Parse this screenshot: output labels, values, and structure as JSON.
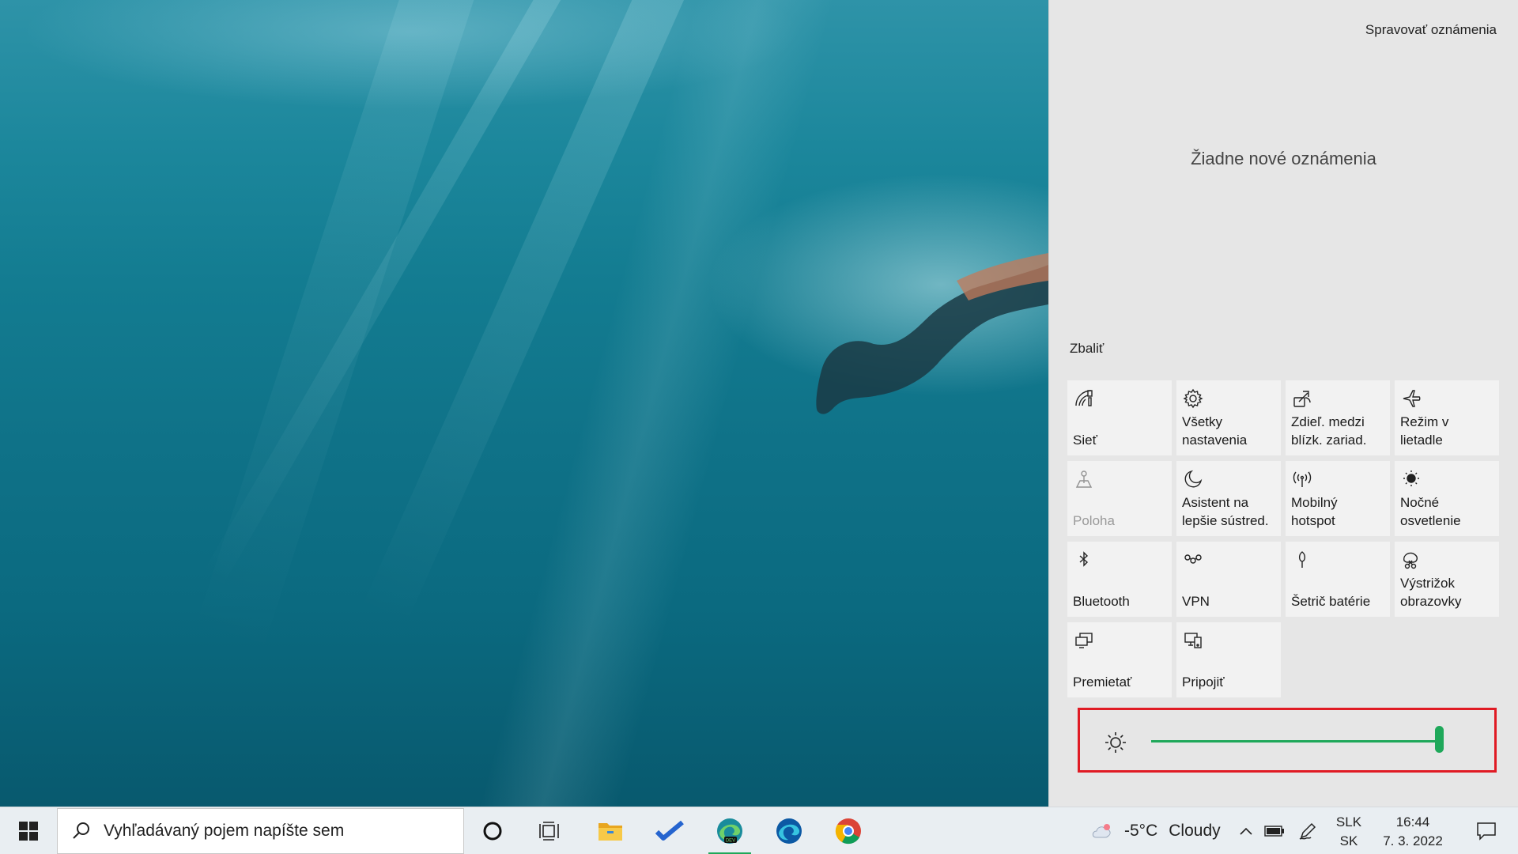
{
  "action_center": {
    "manage_notifications": "Spravovať oznámenia",
    "no_notifications": "Žiadne nové oznámenia",
    "collapse": "Zbaliť",
    "tiles": [
      {
        "label": "Sieť",
        "icon": "network-icon",
        "enabled": true
      },
      {
        "label": "Všetky nastavenia",
        "icon": "gear-icon",
        "enabled": true
      },
      {
        "label": "Zdieľ. medzi blízk. zariad.",
        "icon": "nearby-share-icon",
        "enabled": true
      },
      {
        "label": "Režim v lietadle",
        "icon": "airplane-icon",
        "enabled": true
      },
      {
        "label": "Poloha",
        "icon": "location-icon",
        "enabled": false
      },
      {
        "label": "Asistent na lepšie sústred.",
        "icon": "moon-icon",
        "enabled": true
      },
      {
        "label": "Mobilný hotspot",
        "icon": "hotspot-icon",
        "enabled": true
      },
      {
        "label": "Nočné osvetlenie",
        "icon": "night-light-icon",
        "enabled": true
      },
      {
        "label": "Bluetooth",
        "icon": "bluetooth-icon",
        "enabled": true
      },
      {
        "label": "VPN",
        "icon": "vpn-icon",
        "enabled": true
      },
      {
        "label": "Šetrič batérie",
        "icon": "battery-saver-icon",
        "enabled": true
      },
      {
        "label": "Výstrižok obrazovky",
        "icon": "snip-icon",
        "enabled": true
      },
      {
        "label": "Premietať",
        "icon": "project-icon",
        "enabled": true
      },
      {
        "label": "Pripojiť",
        "icon": "connect-icon",
        "enabled": true
      }
    ],
    "brightness": {
      "value": 1.0,
      "accent": "#1fa85a",
      "highlight": "#e01b24"
    }
  },
  "taskbar": {
    "search_placeholder": "Vyhľadávaný pojem napíšte sem",
    "apps": [
      "cortana-icon",
      "task-view-icon",
      "file-explorer-icon",
      "todo-icon",
      "edge-dev-icon",
      "edge-icon",
      "chrome-icon"
    ],
    "weather": {
      "temp": "-5°C",
      "condition": "Cloudy"
    },
    "language": {
      "top": "SLK",
      "bottom": "SK"
    },
    "clock": {
      "time": "16:44",
      "date": "7. 3. 2022"
    }
  }
}
